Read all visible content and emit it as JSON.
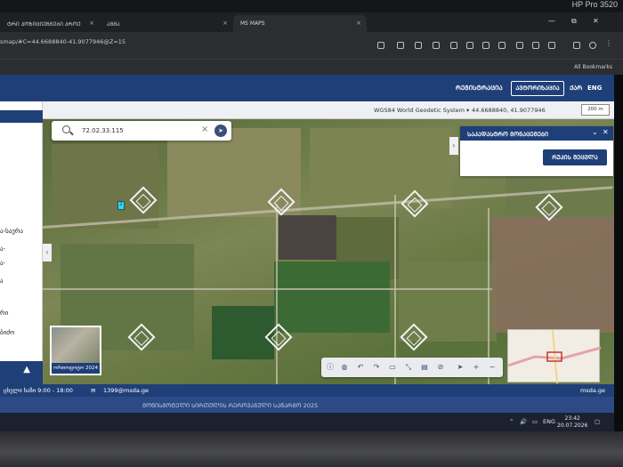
{
  "monitor": {
    "brand": "HP Pro 3520"
  },
  "browser": {
    "tabs": [
      {
        "label": "ᲢᲠᲘ ᲞᲝᲖᲘᲪᲘᲔᲜᲜᲔᲑᲘ ᲞᲠᲝᲔ",
        "close": "×"
      },
      {
        "label": "ᲐᲒᲛᲐ",
        "close": "×"
      },
      {
        "label": "MS MAPS",
        "close": "×"
      }
    ],
    "window_controls": [
      "—",
      "⧉",
      "✕"
    ],
    "url": "smap/#C=44.6688840-41.9077946@Z=15",
    "bookmarks_label": "All Bookmarks"
  },
  "header": {
    "nav": [
      "ᲠᲔᲒᲘᲡᲢᲠᲐᲪᲘᲐ",
      "ᲐᲕᲢᲝᲠᲘᲖᲐᲪᲘᲐ",
      "ᲥᲐᲠ",
      "ENG"
    ]
  },
  "coordbar": {
    "crs": "WGS84 World Geodetic System ▾",
    "coords": "44.6688840, 41.9077946",
    "scale": "200 m"
  },
  "sidebar": {
    "items": [
      "ა-საერა",
      "ა-",
      "ა-",
      "ა",
      "რი",
      "ბიძო"
    ],
    "collapse_icon": "▲"
  },
  "search": {
    "query": "72.02.33.115",
    "clear": "×",
    "go": "➤"
  },
  "cadastre_panel": {
    "title": "ᲡᲐᲙᲐᲓᲐᲡᲢᲠᲝ ᲛᲝᲜᲐᲪᲔᲛᲔᲑᲘ",
    "chevron": "⌄",
    "close": "✕",
    "button": "ᲠᲣᲙᲘᲡ ᲨᲔᲪᲕᲚᲐ"
  },
  "map": {
    "left_arrow": "‹",
    "right_arrow": "›",
    "basemap_label": "ორთოფოტო 2024",
    "marker_text": "2"
  },
  "toolbar": {
    "tools": [
      "ⓘ",
      "◍",
      "↶",
      "↷",
      "▭",
      "⤡",
      "▤",
      "⊘",
      "➤",
      "+",
      "−"
    ]
  },
  "footer": {
    "hours": "ცხელი ხაზი 9:00 - 18:00",
    "email": "1399@msda.ge",
    "site": "msda.ge",
    "copyright": "ᲛᲝᲬᲘᲡᲛᲝᲢᲔᲚᲘ ᲡᲘᲠᲗᲣᲚᲘᲡ ᲠᲔᲠᲝᲕᲐᲜᲣᲚᲘ ᲡᲐᲬᲐᲠᲛᲝ 2025"
  },
  "taskbar": {
    "lang": "ENG",
    "time": "23:42",
    "date": "20.07.2026"
  }
}
